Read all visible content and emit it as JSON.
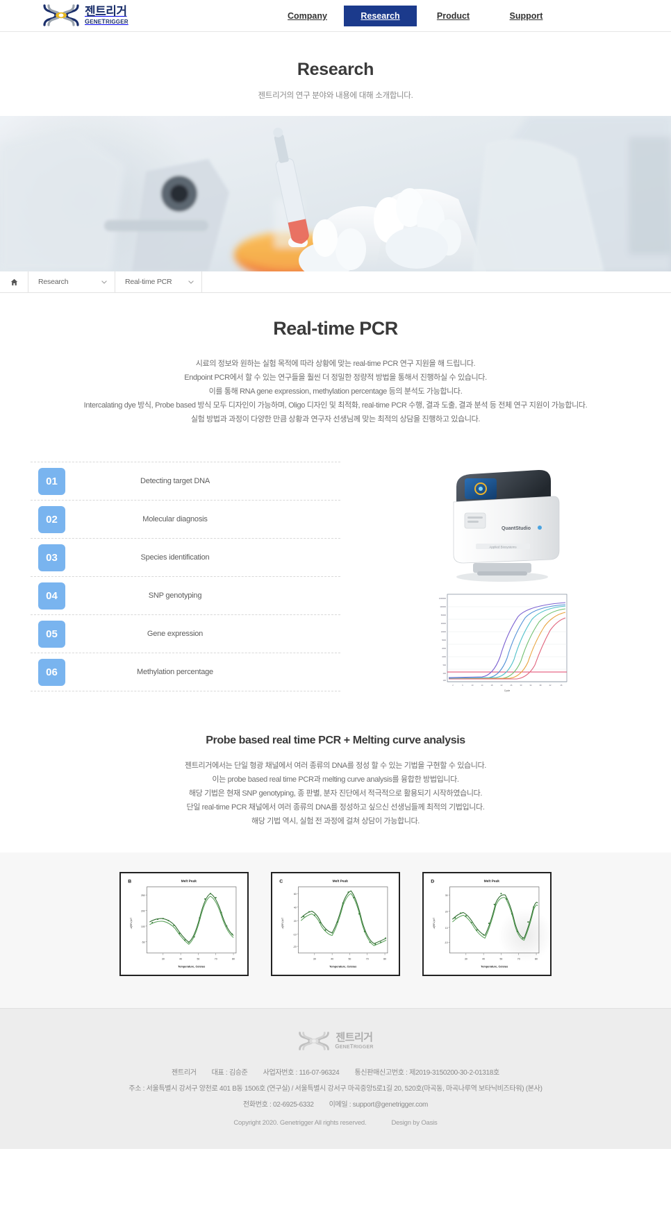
{
  "brand": {
    "name_ko": "젠트리거",
    "name_en_prefix": "G",
    "name_en_1": "ENE",
    "name_en_prefix2": "T",
    "name_en_2": "RIGGER",
    "logo_navy": "#1b2f6b",
    "logo_gray": "#9aa3ad",
    "logo_gold": "#e8b81e"
  },
  "nav": {
    "items": [
      {
        "label": "Company",
        "active": false
      },
      {
        "label": "Research",
        "active": true
      },
      {
        "label": "Product",
        "active": false
      },
      {
        "label": "Support",
        "active": false
      }
    ],
    "active_bg": "#1b3a8c"
  },
  "page_head": {
    "title": "Research",
    "subtitle": "젠트리거의 연구 분야와 내용에 대해 소개합니다."
  },
  "breadcrumb": {
    "home_icon": "home-icon",
    "level1": "Research",
    "level2": "Real-time PCR",
    "chevron_icon": "chevron-down-icon"
  },
  "section": {
    "title": "Real-time PCR",
    "description": [
      "시료의 정보와 원하는 실험 목적에 따라 상황에 맞는 real-time PCR 연구 지원을 해 드립니다.",
      "Endpoint PCR에서 할 수 있는 연구들을 훨씬 더 정밀한 정량적 방법을 통해서 진행하실 수 있습니다.",
      "이를 통해 RNA gene expression, methylation percentage 등의 분석도 가능합니다.",
      "Intercalating dye 방식, Probe based 방식 모두 디자인이 가능하며, Oligo 디자인 및 최적화, real-time PCR 수행, 결과 도출, 결과 분석 등 전체 연구 지원이 가능합니다.",
      "실험 방법과 과정이 다양한 만큼 상황과 연구자 선생님께 맞는 최적의 상담을 진행하고 있습니다."
    ]
  },
  "features": {
    "badge_color": "#79b4ef",
    "items": [
      {
        "num": "01",
        "label": "Detecting target DNA"
      },
      {
        "num": "02",
        "label": "Molecular diagnosis"
      },
      {
        "num": "03",
        "label": "Species identification"
      },
      {
        "num": "04",
        "label": "SNP genotyping"
      },
      {
        "num": "05",
        "label": "Gene expression"
      },
      {
        "num": "06",
        "label": "Methylation percentage"
      }
    ]
  },
  "instrument": {
    "name": "QuantStudio",
    "image_alt": "real-time-pcr-instrument"
  },
  "amplification_chart": {
    "title": "amplification-plot",
    "xlabel": "Cycle"
  },
  "probe_section": {
    "title": "Probe based real time PCR + Melting curve analysis",
    "description": [
      "젠트리거에서는 단일 형광 채널에서 여러 종류의 DNA를 정성 할 수 있는 기법을 구현할 수 있습니다.",
      "이는 probe based real time PCR과 melting curve analysis를 융합한 방법입니다.",
      "해당 기법은 현재 SNP genotyping, 종 판별, 분자 진단에서 적극적으로 활용되기 시작하였습니다.",
      "단일 real-time PCR 채널에서 여러 종류의 DNA를 정성하고 싶으신 선생님들께 최적의 기법입니다.",
      "해당 기법 역시, 실험 전 과정에 걸쳐 상담이 가능합니다."
    ]
  },
  "melt_charts": [
    {
      "panel": "B",
      "title": "Melt Peak",
      "xlabel": "Temperature, Celsius",
      "ylabel": "-d(RFU)/dT"
    },
    {
      "panel": "C",
      "title": "Melt Peak",
      "xlabel": "Temperature, Celsius",
      "ylabel": "-d(RFU)/dT"
    },
    {
      "panel": "D",
      "title": "Melt Peak",
      "xlabel": "Temperature, Celsius",
      "ylabel": "-d(RFU)/dT"
    }
  ],
  "footer": {
    "company": "젠트리거",
    "ceo_label": "대표 : 김승준",
    "biz_no": "사업자번호 : 116-07-96324",
    "mail_order_no": "통신판매신고번호 : 제2019-3150200-30-2-01318호",
    "address": "주소 : 서울특별시 강서구 양천로 401 B동 1506호 (연구실) / 서울특별시 강서구 마곡중앙5로1길 20, 520호(마곡동, 마곡나루역 보타닉비즈타워) (본사)",
    "phone": "전화번호 : 02-6925-6332",
    "email": "이메일 : support@genetrigger.com",
    "copyright": "Copyright 2020. Genetrigger All rights reserved.",
    "design_by": "Design by Oasis"
  }
}
